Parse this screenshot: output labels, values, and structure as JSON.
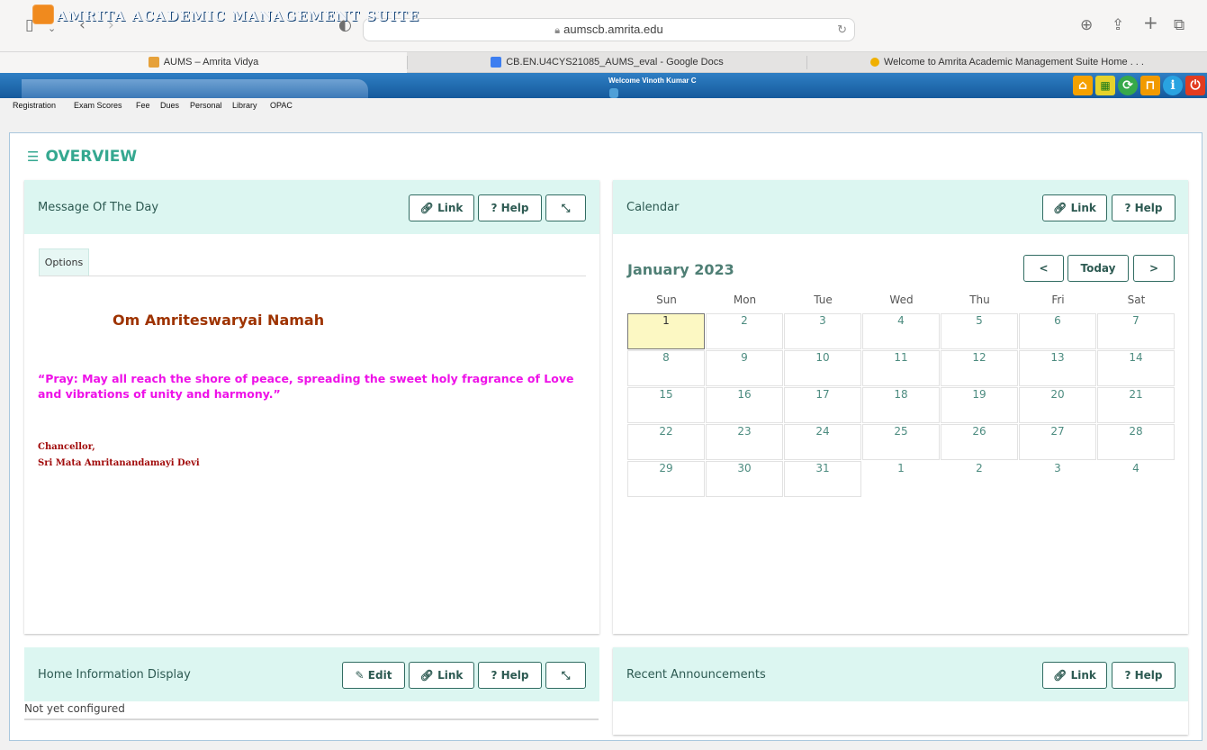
{
  "browser": {
    "url": "aumscb.amrita.edu",
    "tabs": [
      {
        "label": "AUMS – Amrita Vidya",
        "active": true
      },
      {
        "label": "CB.EN.U4CYS21085_AUMS_eval - Google Docs",
        "active": false
      },
      {
        "label": "Welcome to Amrita Academic Management Suite Home . . .",
        "active": false
      }
    ]
  },
  "header": {
    "app_title": "AMRITA ACADEMIC MANAGEMENT SUITE",
    "welcome": "Welcome Vinoth Kumar C",
    "icons": [
      "home-icon",
      "apps-icon",
      "globe-icon",
      "lock-icon",
      "info-icon",
      "power-icon"
    ]
  },
  "menu": [
    "Registration",
    "Exam Scores",
    "Fee",
    "Dues",
    "Personal",
    "Library",
    "OPAC"
  ],
  "overview": {
    "title": "OVERVIEW"
  },
  "motd": {
    "title": "Message Of The Day",
    "link_label": "Link",
    "help_label": "Help",
    "tab": "Options",
    "heading": "Om Amriteswaryai Namah",
    "quote": "“Pray: May all reach the shore of peace, spreading the sweet holy fragrance of Love and vibrations of unity and harmony.”",
    "sig1": "Chancellor,",
    "sig2": "Sri Mata Amritanandamayi Devi"
  },
  "calendar": {
    "title": "Calendar",
    "link_label": "Link",
    "help_label": "Help",
    "month": "January 2023",
    "prev": "<",
    "today": "Today",
    "next": ">",
    "weekdays": [
      "Sun",
      "Mon",
      "Tue",
      "Wed",
      "Thu",
      "Fri",
      "Sat"
    ],
    "weeks": [
      [
        "1",
        "2",
        "3",
        "4",
        "5",
        "6",
        "7"
      ],
      [
        "8",
        "9",
        "10",
        "11",
        "12",
        "13",
        "14"
      ],
      [
        "15",
        "16",
        "17",
        "18",
        "19",
        "20",
        "21"
      ],
      [
        "22",
        "23",
        "24",
        "25",
        "26",
        "27",
        "28"
      ],
      [
        "29",
        "30",
        "31",
        "1",
        "2",
        "3",
        "4"
      ]
    ],
    "selected_day": "1"
  },
  "home_info": {
    "title": "Home Information Display",
    "edit_label": "Edit",
    "link_label": "Link",
    "help_label": "Help",
    "body": "Not yet configured"
  },
  "announcements": {
    "title": "Recent Announcements",
    "link_label": "Link",
    "help_label": "Help"
  }
}
